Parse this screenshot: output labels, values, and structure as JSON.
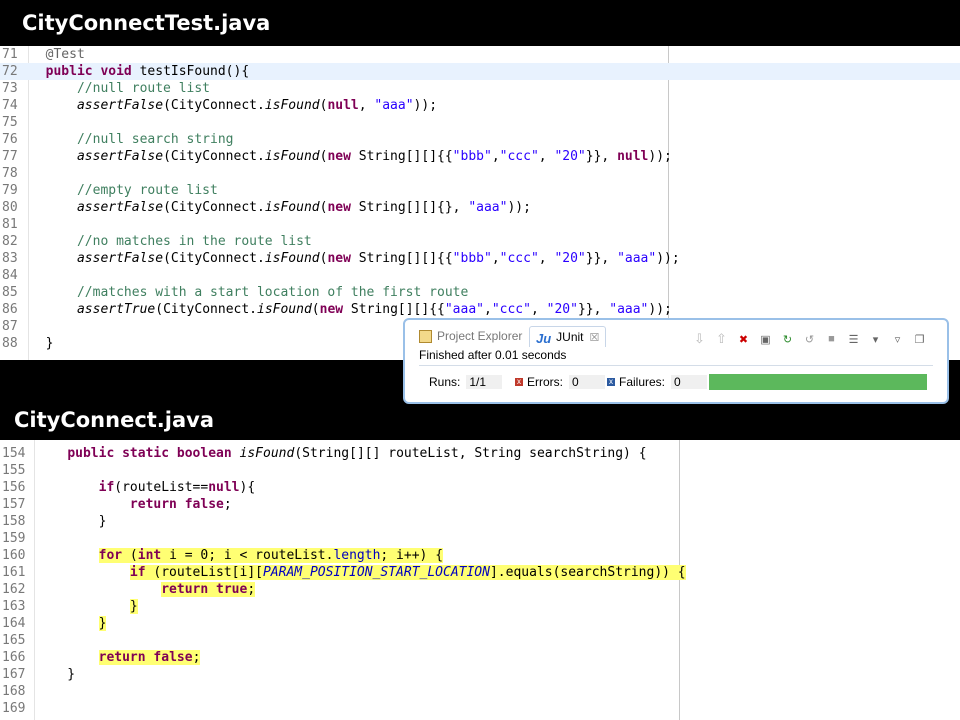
{
  "top_title": "CityConnectTest.java",
  "bottom_title": "CityConnect.java",
  "test_file": {
    "lines": [
      {
        "num": "71",
        "code": "  @Test"
      },
      {
        "num": "72",
        "code": "  public void testIsFound(){"
      },
      {
        "num": "73",
        "code": "      //null route list"
      },
      {
        "num": "74",
        "code": "      assertFalse(CityConnect.isFound(null, \"aaa\"));"
      },
      {
        "num": "75",
        "code": ""
      },
      {
        "num": "76",
        "code": "      //null search string"
      },
      {
        "num": "77",
        "code": "      assertFalse(CityConnect.isFound(new String[][]{{\"bbb\",\"ccc\", \"20\"}}, null));"
      },
      {
        "num": "78",
        "code": ""
      },
      {
        "num": "79",
        "code": "      //empty route list"
      },
      {
        "num": "80",
        "code": "      assertFalse(CityConnect.isFound(new String[][]{}, \"aaa\"));"
      },
      {
        "num": "81",
        "code": ""
      },
      {
        "num": "82",
        "code": "      //no matches in the route list"
      },
      {
        "num": "83",
        "code": "      assertFalse(CityConnect.isFound(new String[][]{{\"bbb\",\"ccc\", \"20\"}}, \"aaa\"));"
      },
      {
        "num": "84",
        "code": ""
      },
      {
        "num": "85",
        "code": "      //matches with a start location of the first route"
      },
      {
        "num": "86",
        "code": "      assertTrue(CityConnect.isFound(new String[][]{{\"aaa\",\"ccc\", \"20\"}}, \"aaa\"));"
      },
      {
        "num": "87",
        "code": ""
      },
      {
        "num": "88",
        "code": "  }"
      }
    ]
  },
  "source_file": {
    "lines": [
      {
        "num": "154",
        "code": "    public static boolean isFound(String[][] routeList, String searchString) {"
      },
      {
        "num": "155",
        "code": ""
      },
      {
        "num": "156",
        "code": "        if(routeList==null){"
      },
      {
        "num": "157",
        "code": "            return false;"
      },
      {
        "num": "158",
        "code": "        }"
      },
      {
        "num": "159",
        "code": ""
      },
      {
        "num": "160",
        "code": "        for (int i = 0; i < routeList.length; i++) {"
      },
      {
        "num": "161",
        "code": "            if (routeList[i][PARAM_POSITION_START_LOCATION].equals(searchString)) {"
      },
      {
        "num": "162",
        "code": "                return true;"
      },
      {
        "num": "163",
        "code": "            }"
      },
      {
        "num": "164",
        "code": "        }"
      },
      {
        "num": "165",
        "code": ""
      },
      {
        "num": "166",
        "code": "        return false;"
      },
      {
        "num": "167",
        "code": "    }"
      },
      {
        "num": "168",
        "code": ""
      },
      {
        "num": "169",
        "code": ""
      }
    ]
  },
  "junit": {
    "tab_project_explorer": "Project Explorer",
    "tab_junit": "JUnit",
    "tab_close": "☒",
    "status": "Finished after 0.01 seconds",
    "runs_label": "Runs:",
    "runs_value": "1/1",
    "errors_label": "Errors:",
    "errors_value": "0",
    "failures_label": "Failures:",
    "failures_value": "0",
    "progress": 1.0,
    "bar_color": "#5cb85c"
  },
  "colors": {
    "keyword": "#7f0055",
    "comment": "#3f7f5f",
    "string": "#2a00ff",
    "highlight": "#ffff73",
    "current_line": "#e8f2fe"
  }
}
